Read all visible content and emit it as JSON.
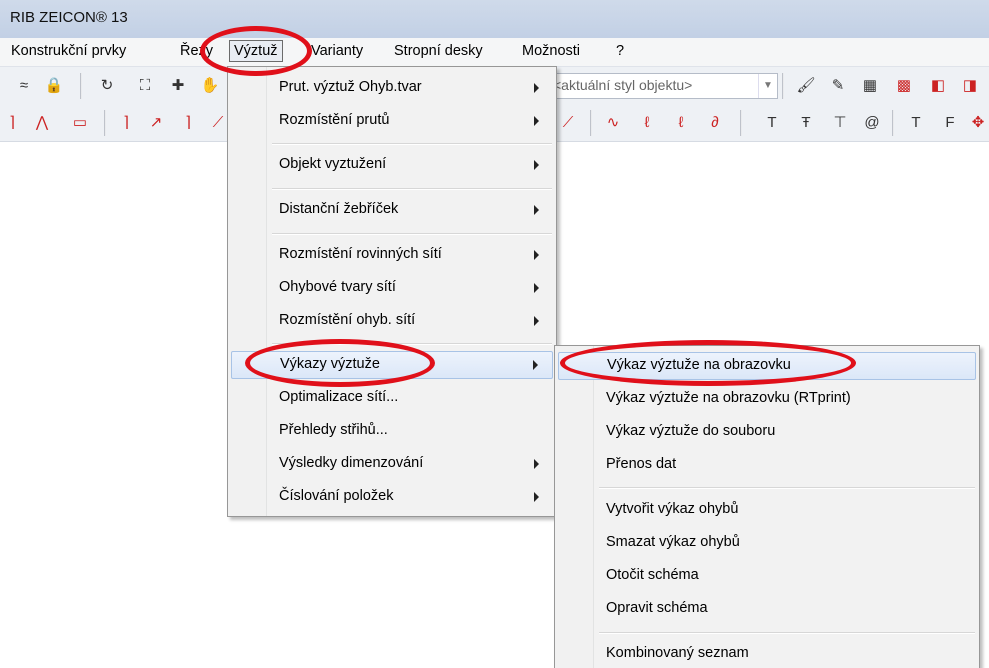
{
  "window": {
    "title": "RIB ZEICON® 13"
  },
  "menubar": {
    "items": [
      "Konstrukční prvky",
      "Řezy",
      "Výztuž",
      "Varianty",
      "Stropní desky",
      "Možnosti",
      "?"
    ]
  },
  "toolbar": {
    "style_placeholder": "<aktuální styl objektu>"
  },
  "vyztuz_menu": {
    "items": [
      {
        "label": "Prut. výztuž Ohyb.tvar",
        "submenu": true
      },
      {
        "label": "Rozmístění prutů",
        "submenu": true
      },
      {
        "label": "Objekt vyztužení",
        "submenu": true
      },
      {
        "label": "Distanční žebříček",
        "submenu": true
      },
      {
        "label": "Rozmístění rovinných sítí",
        "submenu": true
      },
      {
        "label": "Ohybové tvary sítí",
        "submenu": true
      },
      {
        "label": "Rozmístění ohyb. sítí",
        "submenu": true
      },
      {
        "label": "Výkazy výztuže",
        "submenu": true,
        "highlighted": true
      },
      {
        "label": "Optimalizace sítí...",
        "submenu": false
      },
      {
        "label": "Přehledy střihů...",
        "submenu": false
      },
      {
        "label": "Výsledky dimenzování",
        "submenu": true
      },
      {
        "label": "Číslování položek",
        "submenu": true
      }
    ]
  },
  "vykazy_submenu": {
    "items": [
      {
        "label": "Výkaz výztuže na obrazovku",
        "highlighted": true
      },
      {
        "label": "Výkaz výztuže na obrazovku (RTprint)"
      },
      {
        "label": "Výkaz výztuže do souboru"
      },
      {
        "label": "Přenos dat"
      },
      {
        "label": "Vytvořit výkaz ohybů"
      },
      {
        "label": "Smazat výkaz ohybů"
      },
      {
        "label": "Otočit schéma"
      },
      {
        "label": "Opravit schéma"
      },
      {
        "label": "Kombinovaný seznam"
      }
    ]
  },
  "colors": {
    "annotation": "#e0101a",
    "highlight": "#dbe7f8"
  }
}
